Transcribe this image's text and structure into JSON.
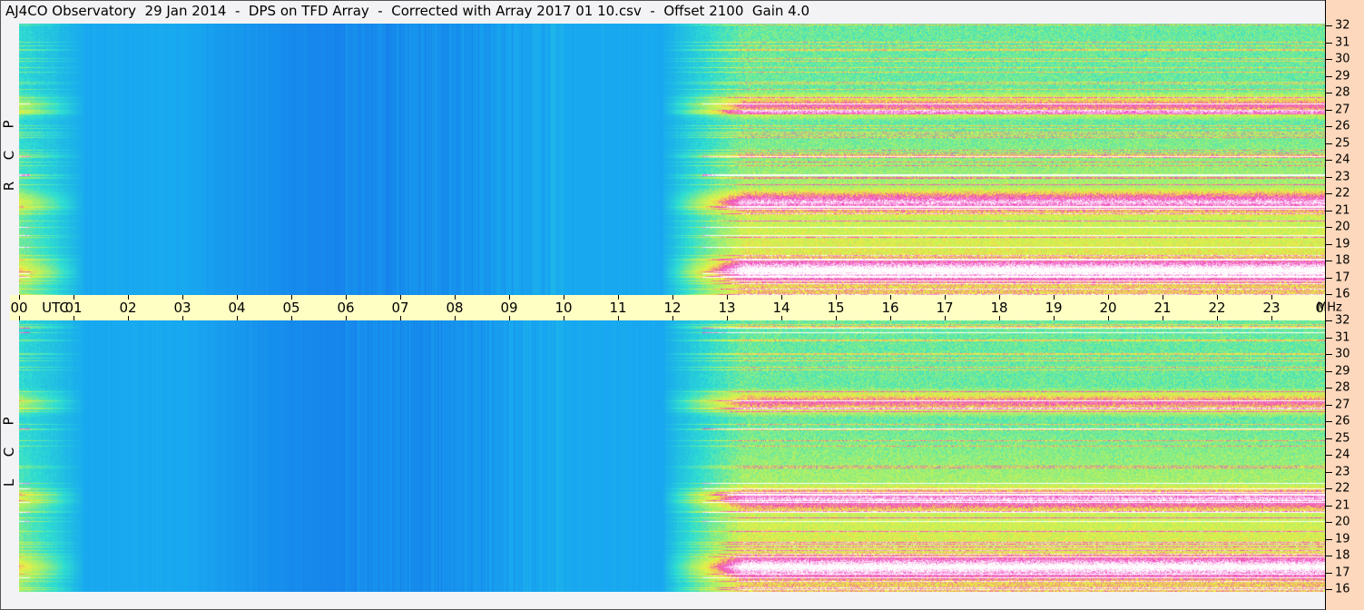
{
  "title": "AJ4CO Observatory  29 Jan 2014  -  DPS on TFD Array  -  Corrected with Array 2017 01 10.csv  -  Offset 2100  Gain 4.0",
  "chart_data": {
    "type": "heatmap",
    "panels": [
      {
        "label_letters": [
          "R",
          "C",
          "P"
        ],
        "polarization": "RCP"
      },
      {
        "label_letters": [
          "L",
          "C",
          "P"
        ],
        "polarization": "LCP"
      }
    ],
    "x_axis": {
      "unit_label": "UTC",
      "range_hours": [
        0,
        24
      ],
      "tick_labels": [
        "00",
        "01",
        "02",
        "03",
        "04",
        "05",
        "06",
        "07",
        "08",
        "09",
        "10",
        "11",
        "12",
        "13",
        "14",
        "15",
        "16",
        "17",
        "18",
        "19",
        "20",
        "21",
        "22",
        "23",
        "00"
      ]
    },
    "y_axis": {
      "unit_label": "MHz",
      "range_mhz": [
        16,
        32
      ],
      "tick_labels": [
        "32",
        "31",
        "30",
        "29",
        "28",
        "27",
        "26",
        "25",
        "24",
        "23",
        "22",
        "21",
        "20",
        "19",
        "18",
        "17",
        "16"
      ]
    },
    "colormap": [
      "#0a3ec8",
      "#1466e8",
      "#18a8f0",
      "#30e0d0",
      "#a0f070",
      "#f0f040",
      "#f040c0",
      "#ffffff"
    ],
    "intense_bands_mhz": [
      17.5,
      21.5,
      27.2
    ],
    "active_period_hours": [
      12,
      24
    ]
  },
  "colors": {
    "time_axis_bg": "#ffffc4",
    "freq_axis_bg": "#fdd8bc",
    "background": "#f3f3f5"
  }
}
